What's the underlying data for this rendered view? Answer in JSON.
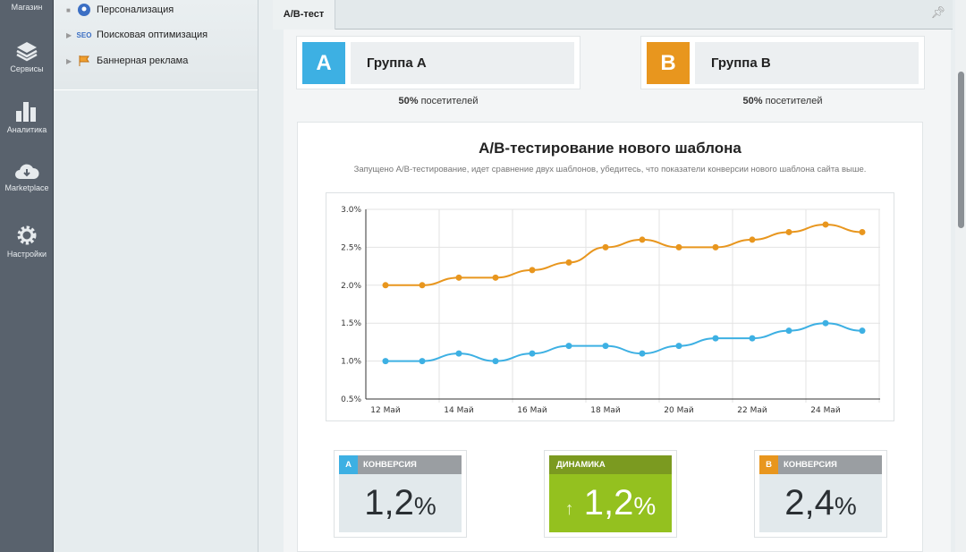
{
  "leftbar": {
    "items": [
      {
        "label": "Магазин",
        "icon": "store-icon"
      },
      {
        "label": "Сервисы",
        "icon": "layers-icon"
      },
      {
        "label": "Аналитика",
        "icon": "bar-chart-icon"
      },
      {
        "label": "Marketplace",
        "icon": "cloud-download-icon"
      },
      {
        "label": "Настройки",
        "icon": "gear-icon"
      }
    ]
  },
  "menu": {
    "items": [
      {
        "label": "Персонализация",
        "icon": "person-icon"
      },
      {
        "label": "Поисковая оптимизация",
        "icon": "seo-icon"
      },
      {
        "label": "Баннерная реклама",
        "icon": "flag-icon"
      }
    ]
  },
  "tab": {
    "label": "А/В-тест"
  },
  "groups": [
    {
      "letter": "A",
      "label": "Группа А",
      "share": "50%",
      "share_text": " посетителей",
      "color": "#3db0e3"
    },
    {
      "letter": "B",
      "label": "Группа В",
      "share": "50%",
      "share_text": " посетителей",
      "color": "#e8961e"
    }
  ],
  "chart_data": {
    "type": "line",
    "title": "А/В-тестирование нового шаблона",
    "subtitle": "Запущено А/В-тестирование, идет сравнение двух шаблонов, убедитесь, что показатели конверсии нового шаблона сайта выше.",
    "x": [
      "12 Май",
      "13 Май",
      "14 Май",
      "15 Май",
      "16 Май",
      "17 Май",
      "18 Май",
      "19 Май",
      "20 Май",
      "21 Май",
      "22 Май",
      "23 Май",
      "24 Май",
      "25 Май"
    ],
    "xticks": [
      "12 Май",
      "14 Май",
      "16 Май",
      "18 Май",
      "20 Май",
      "22 Май",
      "24 Май"
    ],
    "yticks": [
      "0.5%",
      "1.0%",
      "1.5%",
      "2.0%",
      "2.5%",
      "3.0%"
    ],
    "ylim": [
      0.5,
      3.0
    ],
    "grid": true,
    "series": [
      {
        "name": "B",
        "color": "#e8961e",
        "values": [
          2.0,
          2.0,
          2.1,
          2.1,
          2.2,
          2.3,
          2.5,
          2.6,
          2.5,
          2.5,
          2.6,
          2.7,
          2.8,
          2.7
        ]
      },
      {
        "name": "A",
        "color": "#3db0e3",
        "values": [
          1.0,
          1.0,
          1.1,
          1.0,
          1.1,
          1.2,
          1.2,
          1.1,
          1.2,
          1.3,
          1.3,
          1.4,
          1.5,
          1.4
        ]
      }
    ]
  },
  "cards": [
    {
      "badge": "A",
      "title": "КОНВЕРСИЯ",
      "value": "1,2",
      "unit": "%"
    },
    {
      "title": "ДИНАМИКА",
      "arrow": "↑",
      "value": "1,2",
      "unit": "%"
    },
    {
      "badge": "B",
      "title": "КОНВЕРСИЯ",
      "value": "2,4",
      "unit": "%"
    }
  ]
}
